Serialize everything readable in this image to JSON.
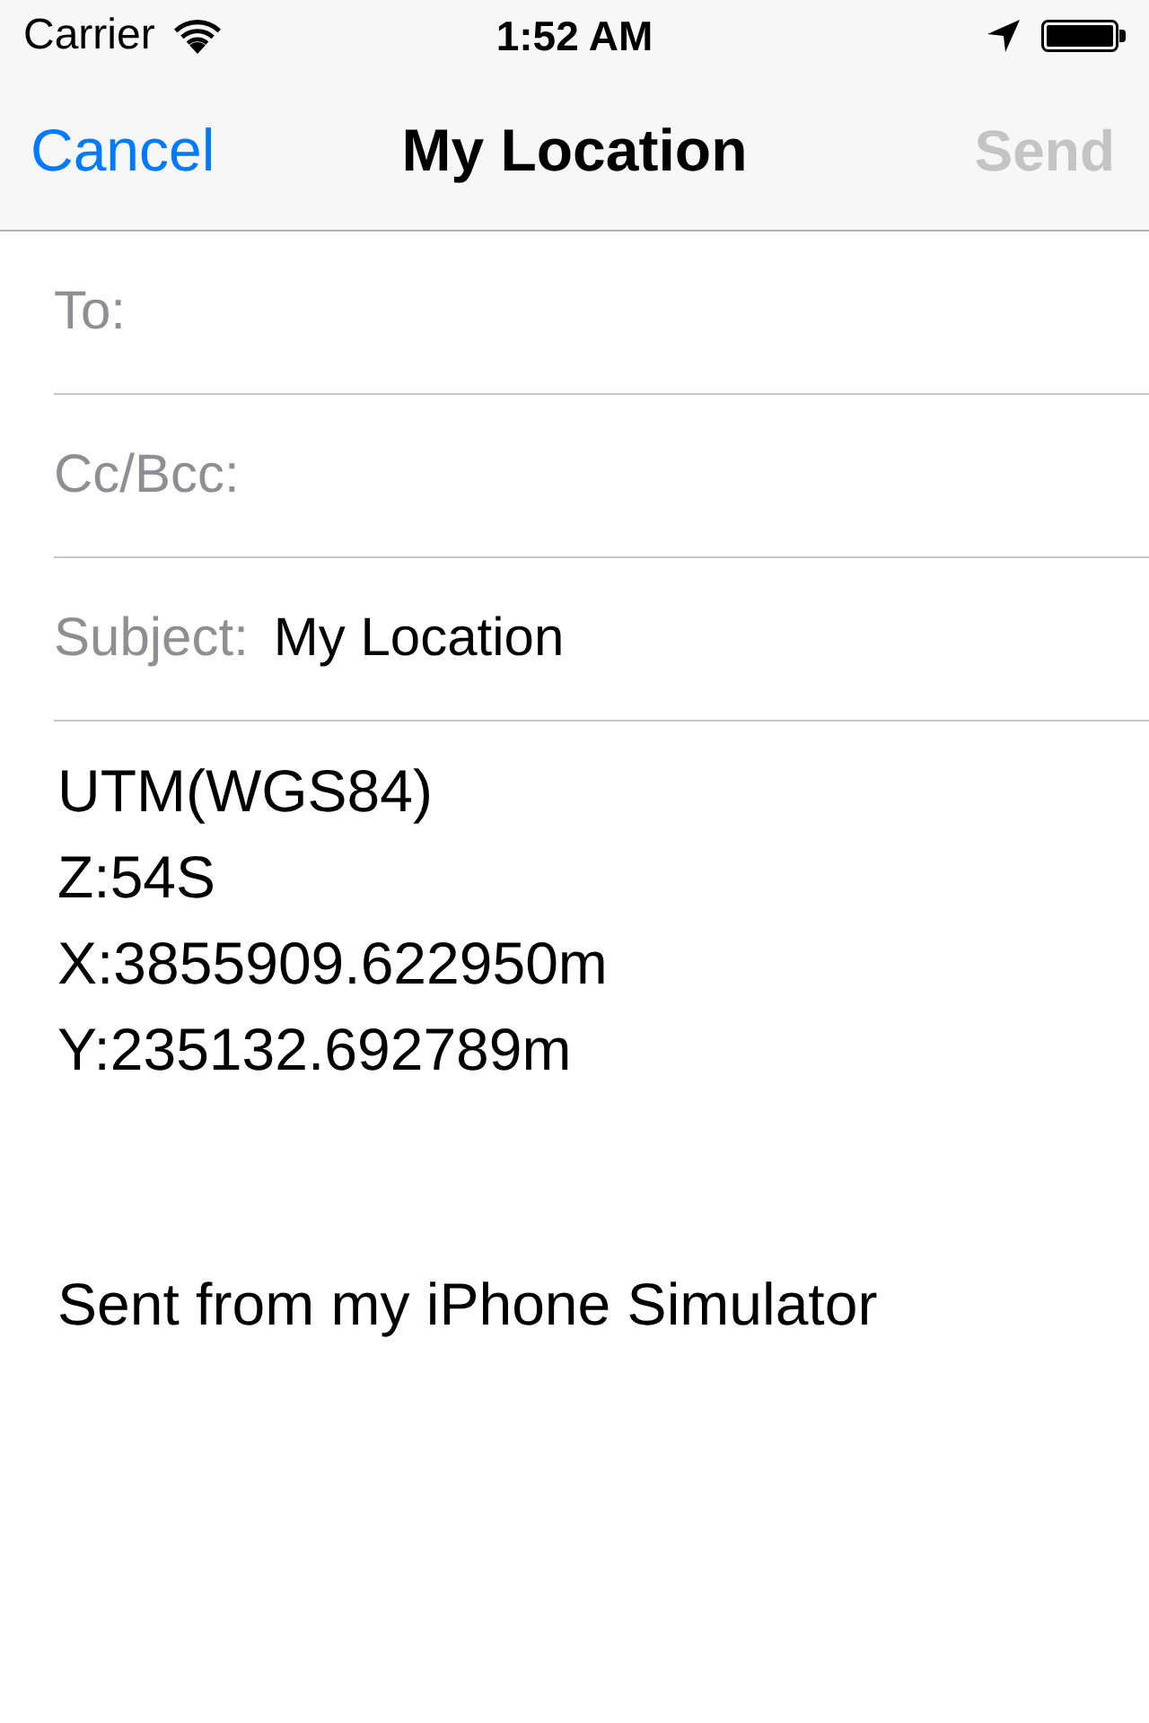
{
  "status_bar": {
    "carrier": "Carrier",
    "time": "1:52 AM"
  },
  "nav_bar": {
    "cancel": {
      "label": "Cancel",
      "disabled": false
    },
    "title": "My Location",
    "send": {
      "label": "Send",
      "disabled": true
    }
  },
  "fields": [
    {
      "label": "To:"
    },
    {
      "label": "Cc/Bcc:"
    },
    {
      "label": "Subject:",
      "value": "My Location"
    }
  ],
  "body": {
    "lines": [
      "UTM(WGS84)",
      "Z:54S",
      "X:3855909.622950m",
      "Y:235132.692789m"
    ],
    "signature": "Sent from my iPhone Simulator"
  }
}
